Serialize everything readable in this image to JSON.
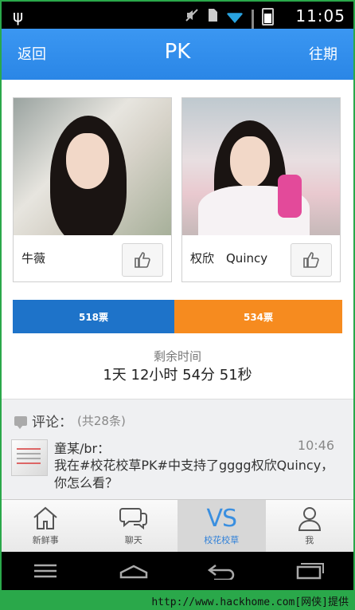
{
  "status_bar": {
    "time": "11:05"
  },
  "header": {
    "back_label": "返回",
    "title": "PK",
    "history_label": "往期"
  },
  "contestants": [
    {
      "name": "牛薇"
    },
    {
      "name": "权欣　Quincy"
    }
  ],
  "votes": {
    "left": "518票",
    "right": "534票",
    "left_color": "#1e73c9",
    "right_color": "#f68b1f"
  },
  "remaining": {
    "label": "剩余时间",
    "value": "1天 12小时 54分 51秒"
  },
  "comments": {
    "label": "评论：",
    "count": "(共28条)",
    "items": [
      {
        "author": "童某/br：",
        "time": "10:46",
        "text": "我在#校花校草PK#中支持了gggg权欣Quincy，你怎么看？"
      }
    ]
  },
  "tabs": [
    {
      "label": "新鲜事",
      "icon": "home-icon"
    },
    {
      "label": "聊天",
      "icon": "chat-icon"
    },
    {
      "label": "校花校草",
      "icon": "vs-icon",
      "glyph": "VS",
      "active": true
    },
    {
      "label": "我",
      "icon": "person-icon"
    }
  ],
  "footer": {
    "text": "http://www.hackhome.com[网侠]提供"
  },
  "accent_color": "#2d8cf0"
}
